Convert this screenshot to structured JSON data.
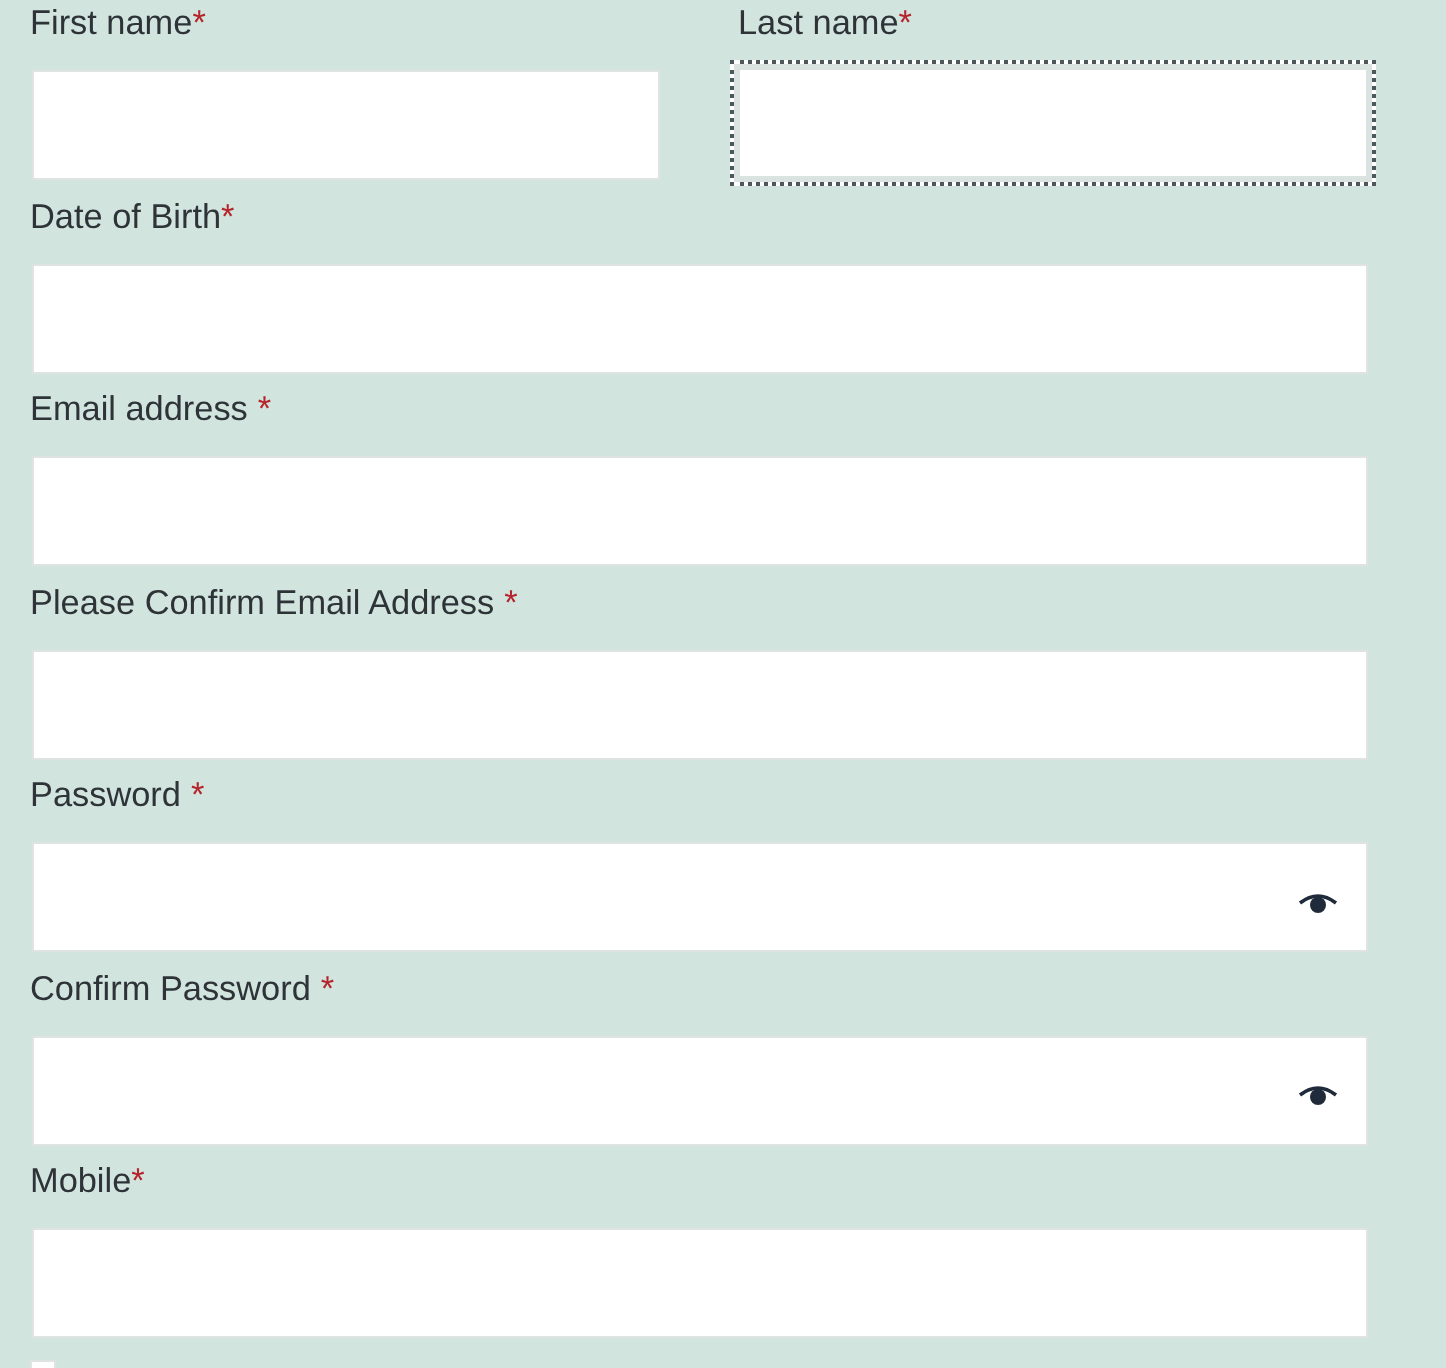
{
  "name_row": [
    {
      "label": "First name",
      "required_mark": "*",
      "mark_spaced": false,
      "focused": false
    },
    {
      "label": "Last name",
      "required_mark": "*",
      "mark_spaced": false,
      "focused": true
    }
  ],
  "fields": [
    {
      "kind": "text",
      "label": "Date of Birth",
      "required_mark": "*",
      "mark_spaced": false,
      "focused": false
    },
    {
      "kind": "text",
      "label": "Email address",
      "required_mark": "*",
      "mark_spaced": true,
      "focused": false
    },
    {
      "kind": "text",
      "label": "Please Confirm Email Address",
      "required_mark": "*",
      "mark_spaced": true,
      "focused": false
    },
    {
      "kind": "password",
      "label": "Password",
      "required_mark": "*",
      "mark_spaced": true,
      "focused": false
    },
    {
      "kind": "password",
      "label": "Confirm Password",
      "required_mark": "*",
      "mark_spaced": true,
      "focused": false
    },
    {
      "kind": "text",
      "label": "Mobile",
      "required_mark": "*",
      "mark_spaced": false,
      "focused": false
    }
  ],
  "checkbox": {
    "checked": false
  }
}
